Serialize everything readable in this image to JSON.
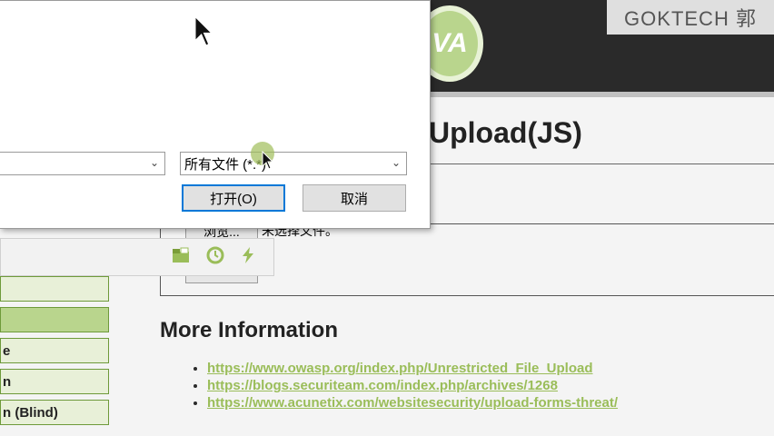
{
  "header": {
    "logo_text": "VA"
  },
  "watermark": {
    "text": "GOKTECH 郭"
  },
  "main": {
    "title": "Upload(JS)",
    "upload": {
      "browse_label": "浏览...",
      "no_file_text": "未选择文件。"
    },
    "more_info": {
      "heading": "More Information",
      "links": [
        "https://www.owasp.org/index.php/Unrestricted_File_Upload",
        "https://blogs.securiteam.com/index.php/archives/1268",
        "https://www.acunetix.com/websitesecurity/upload-forms-threat/"
      ]
    }
  },
  "sidebar": {
    "items": [
      {
        "label": ""
      },
      {
        "label": "",
        "active": true
      },
      {
        "label": "e"
      },
      {
        "label": "n"
      },
      {
        "label": "n (Blind)"
      }
    ]
  },
  "toolbar": {
    "icons": [
      "folder-icon",
      "clock-icon",
      "lightning-icon"
    ]
  },
  "dialog": {
    "filename_value": "",
    "filetype_value": "所有文件 (*.*)",
    "open_label": "打开(O)",
    "cancel_label": "取消"
  },
  "colors": {
    "accent": "#9abd59",
    "header_bg": "#2a2a2a",
    "menu_active": "#b9d58d",
    "focus_border": "#0078d7"
  }
}
